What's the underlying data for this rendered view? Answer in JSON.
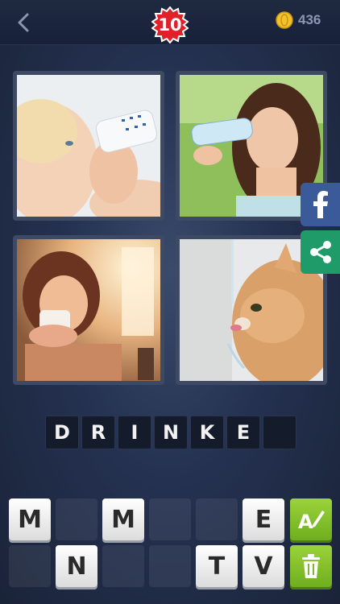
{
  "header": {
    "level": "10",
    "coins": "436"
  },
  "icons": {
    "back": "back-chevron-icon",
    "coin": "coin-icon",
    "facebook": "facebook-icon",
    "share": "share-icon",
    "hint": "hint-pencil-icon",
    "remove": "trash-icon"
  },
  "answer": {
    "slots": [
      "D",
      "R",
      "I",
      "N",
      "K",
      "E",
      ""
    ]
  },
  "keyboard": {
    "row1": [
      "M",
      "",
      "M",
      "",
      "",
      "E"
    ],
    "row2": [
      "",
      "N",
      "",
      "",
      "T",
      "V"
    ]
  },
  "colors": {
    "badge": "#e0212a",
    "facebook": "#3b5a9a",
    "share": "#1f9b6a",
    "green_button": "#8cc63f"
  }
}
